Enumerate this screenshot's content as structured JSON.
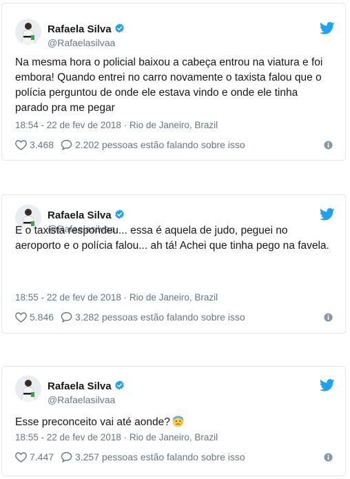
{
  "colors": {
    "accent": "#1da1f2",
    "muted": "#657786",
    "text": "#14171a",
    "border": "#e1e8ed"
  },
  "tweets": [
    {
      "author": "Rafaela Silva",
      "handle": "@Rafaelasilvaa",
      "text": "Na mesma hora o policial baixou a cabeça entrou na viatura e foi embora! Quando entrei no carro novamente o taxista falou que o polícia perguntou de onde ele estava vindo e onde ele tinha parado pra me pegar",
      "meta": "18:54 - 22 de fev de 2018 · Rio de Janeiro, Brazil",
      "likes": "3.468",
      "talking": "2.202 pessoas estão falando sobre isso"
    },
    {
      "author": "Rafaela Silva",
      "handle": "@Rafaelasilvaa",
      "text": "E o taxista respondeu... essa é aquela de judo, peguei no aeroporto e o polícia falou... ah tá! Achei que tinha pego na favela.",
      "meta": "18:55 - 22 de fev de 2018 · Rio de Janeiro, Brazil",
      "likes": "5.846",
      "talking": "3.282 pessoas estão falando sobre isso"
    },
    {
      "author": "Rafaela Silva",
      "handle": "@Rafaelasilvaa",
      "text": "Esse preconceito vai até aonde?",
      "emoji": "anxious-face-emoji",
      "meta": "18:55 - 22 de fev de 2018 · Rio de Janeiro, Brazil",
      "likes": "7.447",
      "talking": "3.257 pessoas estão falando sobre isso"
    }
  ]
}
